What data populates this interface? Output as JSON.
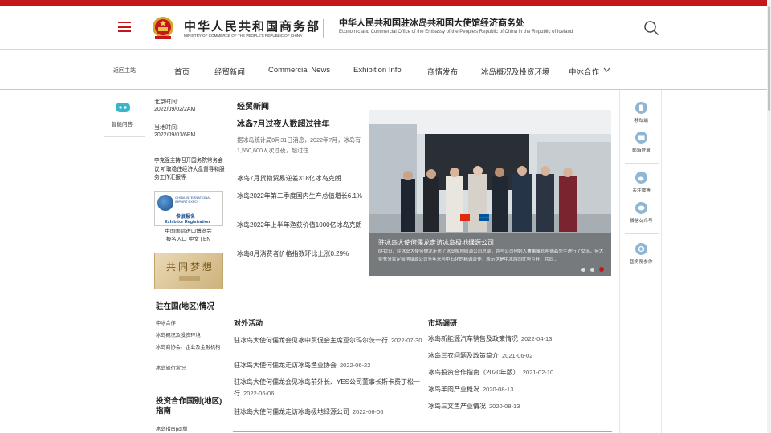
{
  "header": {
    "logo_cn": "中华人民共和国商务部",
    "logo_en": "MINISTRY OF COMMERCE OF THE PEOPLE'S REPUBLIC OF CHINA",
    "embassy_cn": "中华人民共和国驻冰岛共和国大使馆经济商务处",
    "embassy_en": "Economic and Commercial Office of the Embassy of the People's Republic of China in the Republic of Iceland"
  },
  "nav": {
    "back": "返回主站",
    "items": [
      "首页",
      "经贸新闻",
      "Commercial News",
      "Exhibition Info",
      "商情发布",
      "冰岛概况及投资环境",
      "中冰合作"
    ]
  },
  "left_rail": {
    "robot_label": "智能问答"
  },
  "sidebar": {
    "beijing_time_label": "北京时间:",
    "beijing_time": "2022/09/02/2AM",
    "local_time_label": "当地时间:",
    "local_time": "2022/09/01/6PM",
    "feature_news": "李克强主持召开国务院常务会议 听取稳住经济大盘督导和服务工作汇报等",
    "expo_en": "CHINA INTERNATIONAL IMPORT EXPO",
    "expo_cn": "参展报名",
    "expo_reg": "Exhibitor Registration",
    "expo_caption_1": "中国国际进口博览会",
    "expo_caption_2": "报名入口 中文 | EN",
    "dream_text": "共同梦想",
    "section1_title": "驻在国(地区)情况",
    "section1_links": [
      "中冰合作",
      "冰岛概况及投资环境",
      "冰岛商协会、企业及金融机构",
      "冰岛旅行常识"
    ],
    "section2_title": "投资合作国别(地区)指南",
    "section2_links": [
      "冰岛指南pdf版"
    ]
  },
  "main": {
    "section_title": "经贸新闻",
    "headline": "冰岛7月过夜人数超过往年",
    "summary": "据冰岛统计局8月31日消息，2022年7月，冰岛有1,550,600人次过夜，超过往 ...",
    "news": [
      "冰岛7月货物贸易逆差318亿冰岛克朗",
      "冰岛2022年第二季度国内生产总值增长6.1%",
      "冰岛2022年上半年渔获价值1000亿冰岛克朗",
      "冰岛8月消费者价格指数环比上涨0.29%"
    ],
    "hero_title": "驻冰岛大使何儒龙走访冰岛极地绿源公司",
    "hero_desc": "6月2日，驻冰岛大使何儒龙走访了冰岛极地绿源公司总部，并与公司创始人兼董事长哈德森先生进行了交流。何大使充分肯定极地绿源公司多年来与中石化的精诚合作，表示这是中冰两国优势互补、共同...",
    "activities_title": "对外活动",
    "activities": [
      {
        "text": "驻冰岛大使何儒龙会见冰中贸促会主席亚尔玛尔茨一行",
        "date": "2022-07-30"
      },
      {
        "text": "驻冰岛大使何儒龙走访冰岛渔业协会",
        "date": "2022-06-22"
      },
      {
        "text": "驻冰岛大使何儒龙会见冰岛前外长、YES公司董事长斯卡费丁松一行",
        "date": "2022-06-06"
      },
      {
        "text": "驻冰岛大使何儒龙走访冰岛极地绿源公司",
        "date": "2022-06-06"
      }
    ],
    "market_title": "市场调研",
    "market": [
      {
        "text": "冰岛新能源汽车销售及政策情况",
        "date": "2022-04-13"
      },
      {
        "text": "冰岛三农问题及政策简介",
        "date": "2021-06-02"
      },
      {
        "text": "冰岛投资合作指南（2020年版）",
        "date": "2021-02-10"
      },
      {
        "text": "冰岛羊肉产业概况",
        "date": "2020-08-13"
      },
      {
        "text": "冰岛三文鱼产业情况",
        "date": "2020-08-13"
      }
    ]
  },
  "right_rail": [
    "移动端",
    "邮箱登录",
    "关注微博",
    "微信公众号",
    "国务院参你"
  ],
  "colors": {
    "accent": "#c4161c",
    "rail_icon": "#8fb7d4"
  }
}
